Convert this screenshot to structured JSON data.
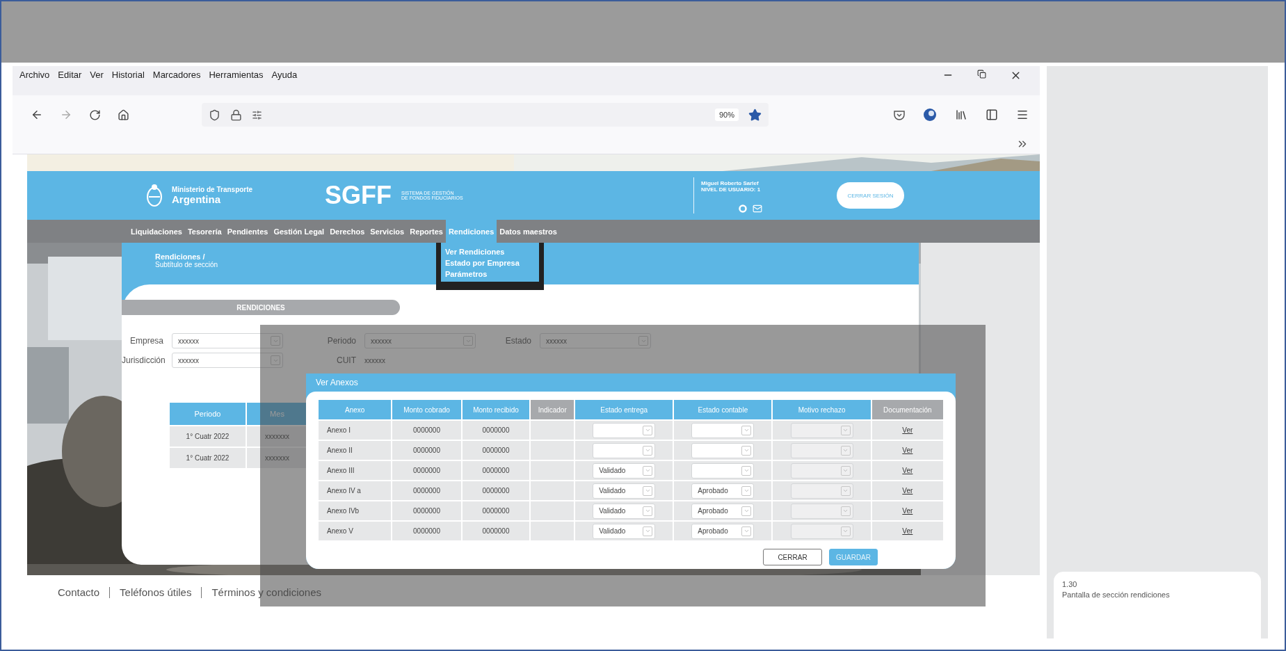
{
  "browser": {
    "menu": [
      "Archivo",
      "Editar",
      "Ver",
      "Historial",
      "Marcadores",
      "Herramientas",
      "Ayuda"
    ],
    "zoom": "90%",
    "bookmarked": true
  },
  "header": {
    "ministry": "Ministerio de Transporte",
    "country": "Argentina",
    "app_name": "SGFF",
    "app_subtitle": [
      "SISTEMA DE GESTIÓN",
      "DE FONDOS FIDUCIARIOS"
    ],
    "user_name": "Miguel Roberto Sarlef",
    "user_level": "NIVEL DE USUARIO: 1",
    "logout": "CERRAR SESIÓN"
  },
  "nav": {
    "items": [
      {
        "label": "Liquidaciones",
        "selected": false
      },
      {
        "label": "Tesorería",
        "selected": false
      },
      {
        "label": "Pendientes",
        "selected": false
      },
      {
        "label": "Gestión Legal",
        "selected": false
      },
      {
        "label": "Derechos",
        "selected": false
      },
      {
        "label": "Servicios",
        "selected": false
      },
      {
        "label": "Reportes",
        "selected": false
      },
      {
        "label": "Rendiciones",
        "selected": true
      },
      {
        "label": "Datos maestros",
        "selected": false
      }
    ],
    "dropdown": [
      "Ver Rendiciones",
      "Estado por Empresa",
      "Parámetros"
    ]
  },
  "section": {
    "title": "Rendiciones /",
    "subtitle": "Subtítulo de sección",
    "tab": "RENDICIONES",
    "filters": [
      [
        {
          "label": "Empresa",
          "value": "xxxxxx",
          "kind": "select"
        },
        {
          "label": "Periodo",
          "value": "xxxxxx",
          "kind": "select"
        },
        {
          "label": "Estado",
          "value": "xxxxxx",
          "kind": "select"
        }
      ],
      [
        {
          "label": "Jurisdicción",
          "value": "xxxxxx",
          "kind": "select"
        },
        {
          "label": "CUIT",
          "value": "xxxxxx",
          "kind": "text"
        }
      ]
    ],
    "periods": {
      "columns": [
        "Periodo",
        "Mes"
      ],
      "rows": [
        [
          "1° Cuatr 2022",
          "xxxxxxx"
        ],
        [
          "1° Cuatr 2022",
          "xxxxxxx"
        ]
      ]
    }
  },
  "modal": {
    "title": "Ver Anexos",
    "columns": [
      {
        "label": "Anexo",
        "color": "#5cb6e4"
      },
      {
        "label": "Monto cobrado",
        "color": "#5cb6e4"
      },
      {
        "label": "Monto recibido",
        "color": "#5cb6e4"
      },
      {
        "label": "Indicador",
        "color": "#a7a9ac"
      },
      {
        "label": "Estado entrega",
        "color": "#5cb6e4"
      },
      {
        "label": "Estado contable",
        "color": "#5cb6e4"
      },
      {
        "label": "Motivo rechazo",
        "color": "#5cb6e4"
      },
      {
        "label": "Documentación",
        "color": "#a7a9ac"
      }
    ],
    "rows": [
      {
        "anexo": "Anexo I",
        "monto_cobrado": "0000000",
        "monto_recibido": "0000000",
        "estado_entrega": {
          "disabled": false
        },
        "estado_contable": {
          "disabled": false
        },
        "motivo_rechazo": {
          "disabled": true
        },
        "documentacion": "Ver"
      },
      {
        "anexo": "Anexo II",
        "monto_cobrado": "0000000",
        "monto_recibido": "0000000",
        "estado_entrega": {
          "disabled": false
        },
        "estado_contable": {
          "disabled": false
        },
        "motivo_rechazo": {
          "disabled": true
        },
        "documentacion": "Ver"
      },
      {
        "anexo": "Anexo III",
        "monto_cobrado": "0000000",
        "monto_recibido": "0000000",
        "estado_entrega": {
          "value": "Validado",
          "disabled": false
        },
        "estado_contable": {
          "disabled": false
        },
        "motivo_rechazo": {
          "disabled": true
        },
        "documentacion": "Ver"
      },
      {
        "anexo": "Anexo IV a",
        "monto_cobrado": "0000000",
        "monto_recibido": "0000000",
        "estado_entrega": {
          "value": "Validado",
          "disabled": false
        },
        "estado_contable": {
          "value": "Aprobado",
          "disabled": false
        },
        "motivo_rechazo": {
          "disabled": true
        },
        "documentacion": "Ver"
      },
      {
        "anexo": "Anexo IVb",
        "monto_cobrado": "0000000",
        "monto_recibido": "0000000",
        "estado_entrega": {
          "value": "Validado",
          "disabled": false
        },
        "estado_contable": {
          "value": "Aprobado",
          "disabled": false
        },
        "motivo_rechazo": {
          "disabled": true
        },
        "documentacion": "Ver"
      },
      {
        "anexo": "Anexo V",
        "monto_cobrado": "0000000",
        "monto_recibido": "0000000",
        "estado_entrega": {
          "value": "Validado",
          "disabled": false
        },
        "estado_contable": {
          "value": "Aprobado",
          "disabled": false
        },
        "motivo_rechazo": {
          "disabled": true
        },
        "documentacion": "Ver"
      }
    ],
    "buttons": [
      {
        "label": "CERRAR",
        "kind": "secondary"
      },
      {
        "label": "GUARDAR",
        "kind": "primary"
      }
    ]
  },
  "footer": [
    "Contacto",
    "Teléfonos útiles",
    "Términos y condiciones"
  ],
  "note": {
    "number": "1.30",
    "caption": "Pantalla de sección rendiciones"
  }
}
